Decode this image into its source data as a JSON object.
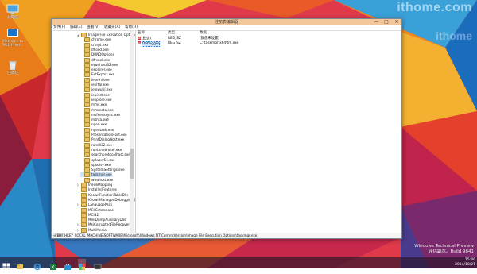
{
  "watermark": {
    "line1": "ithome.com",
    "line2": "ithome"
  },
  "desktop_icons": [
    {
      "label": "此电脑",
      "icon": "computer-icon"
    },
    {
      "label": "Welcome to Tech Previ...",
      "icon": "welcome-icon"
    },
    {
      "label": "回收站",
      "icon": "recycle-bin-icon"
    }
  ],
  "window": {
    "title": "注册表编辑器",
    "controls": {
      "minimize": "—",
      "maximize": "□",
      "close": "✕"
    },
    "menu": [
      "文件(F)",
      "编辑(E)",
      "查看(V)",
      "收藏夹(A)",
      "帮助(H)"
    ],
    "tree": [
      {
        "label": "Image File Execution Options",
        "indent": 1,
        "expander": "◢",
        "selected": false
      },
      {
        "label": "chrome.exe",
        "indent": 2,
        "expander": "",
        "selected": false
      },
      {
        "label": "crorpt.exe",
        "indent": 2,
        "expander": "",
        "selected": false
      },
      {
        "label": "dflood.exe",
        "indent": 2,
        "expander": "",
        "selected": false
      },
      {
        "label": "DRNDOptions",
        "indent": 2,
        "expander": "",
        "selected": false
      },
      {
        "label": "dfrsnel.exe",
        "indent": 2,
        "expander": "",
        "selected": false
      },
      {
        "label": "etwdhost32.exe",
        "indent": 2,
        "expander": "",
        "selected": false
      },
      {
        "label": "explorer.exe",
        "indent": 2,
        "expander": "",
        "selected": false
      },
      {
        "label": "ExtExport.exe",
        "indent": 2,
        "expander": "",
        "selected": false
      },
      {
        "label": "iekeml.exe",
        "indent": 2,
        "expander": "",
        "selected": false
      },
      {
        "label": "iexrtal.exe",
        "indent": 2,
        "expander": "",
        "selected": false
      },
      {
        "label": "ielowutil.exe",
        "indent": 2,
        "expander": "",
        "selected": false
      },
      {
        "label": "ieuinst.exe",
        "indent": 2,
        "expander": "",
        "selected": false
      },
      {
        "label": "iexplore.exe",
        "indent": 2,
        "expander": "",
        "selected": false
      },
      {
        "label": "mmc.exe",
        "indent": 2,
        "expander": "",
        "selected": false
      },
      {
        "label": "mmmoto.exe",
        "indent": 2,
        "expander": "",
        "selected": false
      },
      {
        "label": "msfeedssync.exe",
        "indent": 2,
        "expander": "",
        "selected": false
      },
      {
        "label": "mshta.exe",
        "indent": 2,
        "expander": "",
        "selected": false
      },
      {
        "label": "ngen.exe",
        "indent": 2,
        "expander": "",
        "selected": false
      },
      {
        "label": "ngentask.exe",
        "indent": 2,
        "expander": "",
        "selected": false
      },
      {
        "label": "PresentationHost.exe",
        "indent": 2,
        "expander": "",
        "selected": false
      },
      {
        "label": "PrintDialogHost.exe",
        "indent": 2,
        "expander": "",
        "selected": false
      },
      {
        "label": "rundll32.exe",
        "indent": 2,
        "expander": "",
        "selected": false
      },
      {
        "label": "runtimebroker.exe",
        "indent": 2,
        "expander": "",
        "selected": false
      },
      {
        "label": "searchprotocolhost.exe",
        "indent": 2,
        "expander": "",
        "selected": false
      },
      {
        "label": "splwow64.exe",
        "indent": 2,
        "expander": "",
        "selected": false
      },
      {
        "label": "spoolsv.exe",
        "indent": 2,
        "expander": "",
        "selected": false
      },
      {
        "label": "SystemSettings.exe",
        "indent": 2,
        "expander": "",
        "selected": false
      },
      {
        "label": "taskmgr.exe",
        "indent": 2,
        "expander": "",
        "selected": true
      },
      {
        "label": "wwahost.exe",
        "indent": 2,
        "expander": "",
        "selected": false
      },
      {
        "label": "IniFileMapping",
        "indent": 1,
        "expander": "▷",
        "selected": false
      },
      {
        "label": "InstalledFeatures",
        "indent": 1,
        "expander": "",
        "selected": false
      },
      {
        "label": "KnownFunctionTableDlls",
        "indent": 1,
        "expander": "",
        "selected": false
      },
      {
        "label": "KnownManagedDebuggingDlls",
        "indent": 1,
        "expander": "",
        "selected": false
      },
      {
        "label": "LanguagePack",
        "indent": 1,
        "expander": "▷",
        "selected": false
      },
      {
        "label": "MCI Extensions",
        "indent": 1,
        "expander": "",
        "selected": false
      },
      {
        "label": "MCI32",
        "indent": 1,
        "expander": "",
        "selected": false
      },
      {
        "label": "MiniDumpAuxiliaryDlls",
        "indent": 1,
        "expander": "",
        "selected": false
      },
      {
        "label": "MsiCorruptedFileRecovery",
        "indent": 1,
        "expander": "▷",
        "selected": false
      },
      {
        "label": "MultiMedia",
        "indent": 1,
        "expander": "▷",
        "selected": false
      }
    ],
    "columns": [
      "名称",
      "类型",
      "数据"
    ],
    "values": [
      {
        "icon": "ab",
        "name": "(默认)",
        "type": "REG_SZ",
        "data": "(数值未设置)",
        "selected": false
      },
      {
        "icon": "ab",
        "name": "Debugger",
        "type": "REG_SZ",
        "data": "C:\\taskmgr\\x64\\tm.exe",
        "selected": true
      }
    ],
    "status_path": "计算机\\HKEY_LOCAL_MACHINE\\SOFTWARE\\Microsoft\\Windows NT\\CurrentVersion\\Image File Execution Options\\taskmgr.exe"
  },
  "taskbar": {
    "apps": [
      "start-icon",
      "file-explorer-icon",
      "internet-explorer-icon",
      "excel-icon",
      "store-icon",
      "registry-editor-icon",
      "terminal-icon"
    ],
    "tray": {
      "time": "15:46",
      "date": "2014/10/21"
    }
  },
  "system_watermark": {
    "line1": "Windows Technical Preview",
    "line2": "评估副本。Build 9841"
  },
  "colors": {
    "title_bar": "#f4c79b",
    "selection": "#cde3f7",
    "taskbar": "#2a142a"
  }
}
